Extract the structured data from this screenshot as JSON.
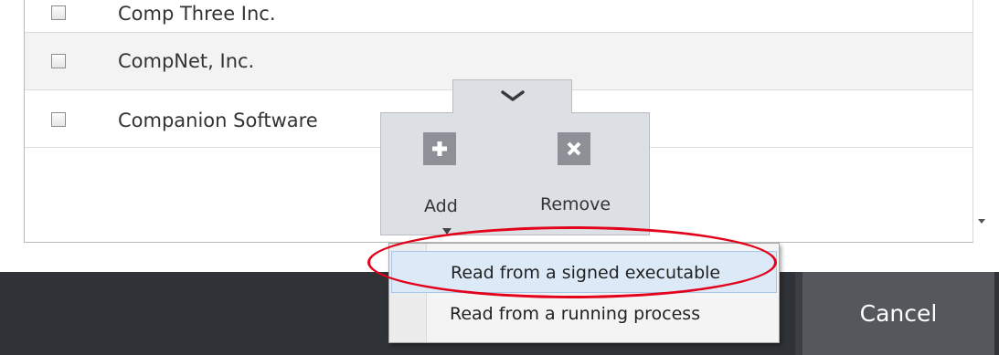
{
  "list": {
    "rows": [
      {
        "label": "Comp Three Inc."
      },
      {
        "label": "CompNet, Inc."
      },
      {
        "label": "Companion Software"
      }
    ]
  },
  "actions": {
    "add_label": "Add",
    "remove_label": "Remove"
  },
  "dropdown": {
    "items": [
      {
        "label": "Read from a signed executable"
      },
      {
        "label": "Read from a running process"
      }
    ]
  },
  "footer": {
    "cancel_label": "Cancel"
  },
  "colors": {
    "highlight_ring": "#e3001b",
    "footer_bg": "#2f3236",
    "cancel_bg": "#54575c"
  }
}
